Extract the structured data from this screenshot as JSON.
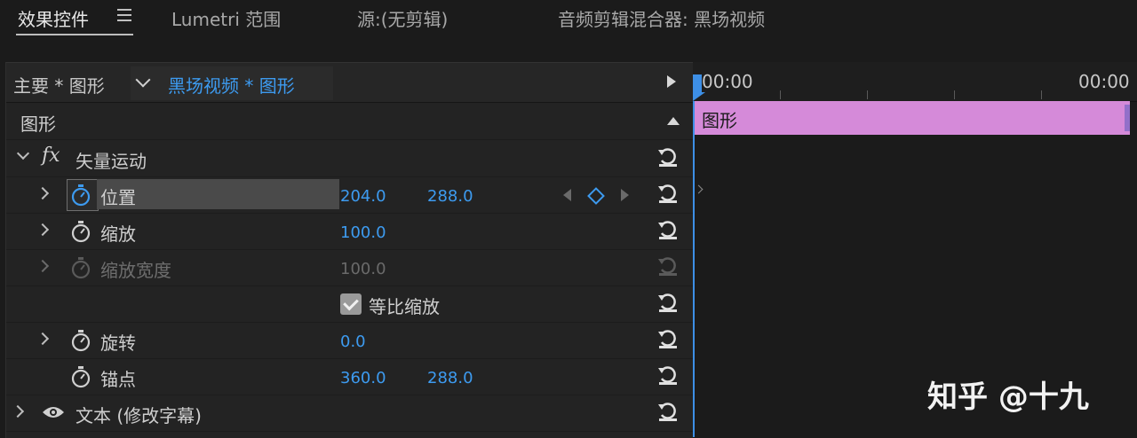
{
  "tabs": {
    "effect_controls": "效果控件",
    "lumetri_scope": "Lumetri 范围",
    "source": "源:(无剪辑)",
    "audio_mixer": "音频剪辑混合器: 黑场视频"
  },
  "sequence": {
    "master_label": "主要 * 图形",
    "clip_label": "黑场视频 * 图形"
  },
  "section_label": "图形",
  "vector_motion": {
    "fx_label": "fx",
    "label": "矢量运动"
  },
  "params": [
    {
      "label": "位置",
      "value1": "204.0",
      "value2": "288.0"
    },
    {
      "label": "缩放",
      "value1": "100.0"
    },
    {
      "label": "缩放宽度",
      "value1": "100.0"
    },
    {
      "label": "等比缩放",
      "checked": true
    },
    {
      "label": "旋转",
      "value1": "0.0"
    },
    {
      "label": "锚点",
      "value1": "360.0",
      "value2": "288.0"
    }
  ],
  "text_layer": {
    "label": "文本 (修改字幕)"
  },
  "timeline": {
    "tc_start": "00:00",
    "tc_end": "00:00",
    "clip_label": "图形"
  },
  "watermark": "知乎 @十九",
  "colors": {
    "accent_blue": "#3d9bf0",
    "clip_pink": "#d58ad9",
    "panel_bg": "#232323"
  },
  "icons": [
    "hamburger-icon",
    "chevron-down-icon",
    "play-icon",
    "collapse-up-icon",
    "reset-icon",
    "stopwatch-icon",
    "keyframe-diamond-icon",
    "eye-icon",
    "checkbox-checked-icon"
  ]
}
